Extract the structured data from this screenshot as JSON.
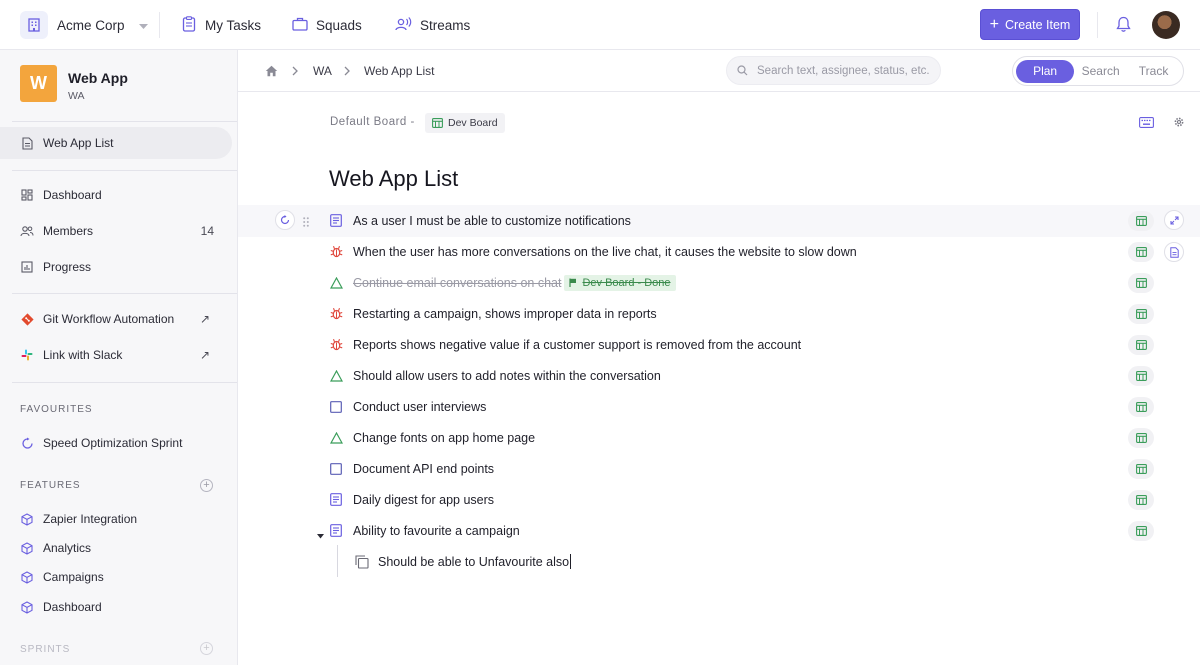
{
  "topbar": {
    "org_name": "Acme Corp",
    "nav": [
      {
        "label": "My Tasks",
        "icon": "clipboard-icon"
      },
      {
        "label": "Squads",
        "icon": "briefcase-icon"
      },
      {
        "label": "Streams",
        "icon": "broadcast-icon"
      }
    ],
    "create_label": "Create Item",
    "accent": "#6a5fe0"
  },
  "project": {
    "logo_letter": "W",
    "name": "Web App",
    "key": "WA",
    "logo_color": "#f3a53d"
  },
  "sidebar": {
    "active_item": "Web App List",
    "items": [
      {
        "label": "Dashboard",
        "icon": "dashboard-icon"
      },
      {
        "label": "Members",
        "icon": "members-icon",
        "count": "14"
      },
      {
        "label": "Progress",
        "icon": "chart-icon"
      }
    ],
    "integrations": [
      {
        "label": "Git Workflow Automation",
        "icon": "git-icon",
        "ext": "↗"
      },
      {
        "label": "Link with Slack",
        "icon": "slack-icon",
        "ext": "↗"
      }
    ],
    "favourites_title": "FAVOURITES",
    "favourites": [
      {
        "label": "Speed Optimization Sprint",
        "icon": "sprint-icon"
      }
    ],
    "features_title": "FEATURES",
    "features": [
      {
        "label": "Zapier Integration"
      },
      {
        "label": "Analytics"
      },
      {
        "label": "Campaigns"
      },
      {
        "label": "Dashboard"
      }
    ],
    "sprints_title": "SPRINTS"
  },
  "breadcrumb": {
    "items": [
      "WA",
      "Web App List"
    ]
  },
  "search": {
    "placeholder": "Search text, assignee, status, etc."
  },
  "modes": [
    "Plan",
    "Search",
    "Track"
  ],
  "active_mode": "Plan",
  "board": {
    "label": "Default Board -",
    "chip": "Dev Board"
  },
  "page_title": "Web App List",
  "items": [
    {
      "title": "As a user I must be able to customize notifications",
      "type": "story"
    },
    {
      "title": "When the user has more conversations on the live chat, it causes the website to slow down",
      "type": "bug"
    },
    {
      "title": "Continue email conversations on chat",
      "type": "improvement",
      "done": true,
      "status": "Dev Board - Done"
    },
    {
      "title": "Restarting a campaign, shows improper data in reports",
      "type": "bug"
    },
    {
      "title": "Reports shows negative value if a customer support is removed from the account",
      "type": "bug"
    },
    {
      "title": "Should allow users to add notes within the conversation",
      "type": "improvement"
    },
    {
      "title": "Conduct user interviews",
      "type": "task"
    },
    {
      "title": "Change fonts on app home page",
      "type": "improvement"
    },
    {
      "title": "Document API end points",
      "type": "task"
    },
    {
      "title": "Daily digest for app users",
      "type": "story"
    },
    {
      "title": "Ability to favourite a campaign",
      "type": "story",
      "expanded": true
    }
  ],
  "subitem": {
    "title": "Should be able to Unfavourite also",
    "type": "subtask"
  },
  "colors": {
    "story": "#6a5fe0",
    "bug": "#e0483d",
    "improvement": "#3a9d5a",
    "task": "#5b5fb5",
    "board": "#3a9d5a"
  }
}
